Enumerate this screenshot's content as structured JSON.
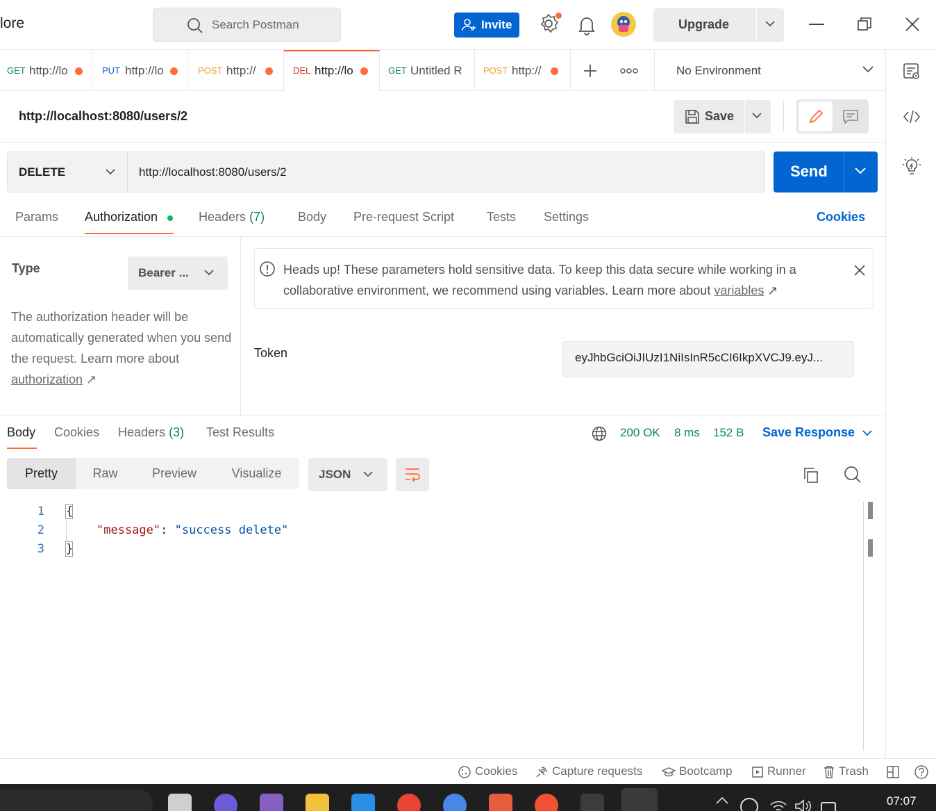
{
  "app": {
    "title_fragment": "lore"
  },
  "header": {
    "search_placeholder": "Search Postman",
    "invite_label": "Invite",
    "upgrade_label": "Upgrade"
  },
  "tabs": [
    {
      "method": "GET",
      "url": "http://lo",
      "dot": true
    },
    {
      "method": "PUT",
      "url": "http://lo",
      "dot": true
    },
    {
      "method": "POST",
      "url": "http://",
      "dot": true
    },
    {
      "method": "DEL",
      "url": "http://lo",
      "dot": true,
      "active": true
    },
    {
      "method": "GET",
      "url": "Untitled R",
      "dot": false
    },
    {
      "method": "POST",
      "url": "http://",
      "dot": true
    }
  ],
  "environment": {
    "selected": "No Environment"
  },
  "request": {
    "title": "http://localhost:8080/users/2",
    "save_label": "Save",
    "method": "DELETE",
    "url": "http://localhost:8080/users/2",
    "send_label": "Send"
  },
  "request_tabs": {
    "params": "Params",
    "authorization": "Authorization",
    "headers": "Headers",
    "headers_count": "(7)",
    "body": "Body",
    "pre_request": "Pre-request Script",
    "tests": "Tests",
    "settings": "Settings",
    "cookies": "Cookies"
  },
  "auth": {
    "type_label": "Type",
    "type_value": "Bearer ...",
    "description": "The authorization header will be automatically generated when you send the request. Learn more about",
    "description_link": "authorization",
    "alert_text": "Heads up! These parameters hold sensitive data. To keep this data secure while working in a collaborative environment, we recommend using variables. Learn more about",
    "alert_link": "variables",
    "token_label": "Token",
    "token_value": "eyJhbGciOiJIUzI1NiIsInR5cCI6IkpXVCJ9.eyJ..."
  },
  "response_tabs": {
    "body": "Body",
    "cookies": "Cookies",
    "headers": "Headers",
    "headers_count": "(3)",
    "test_results": "Test Results"
  },
  "response_status": {
    "status": "200 OK",
    "time": "8 ms",
    "size": "152 B",
    "save_response": "Save Response"
  },
  "views": {
    "pretty": "Pretty",
    "raw": "Raw",
    "preview": "Preview",
    "visualize": "Visualize",
    "format": "JSON"
  },
  "response_body": {
    "line_numbers": [
      "1",
      "2",
      "3"
    ],
    "open_brace": "{",
    "key": "\"message\"",
    "colon": ": ",
    "value": "\"success delete\"",
    "close_brace": "}"
  },
  "footer": {
    "cookies": "Cookies",
    "capture": "Capture requests",
    "bootcamp": "Bootcamp",
    "runner": "Runner",
    "trash": "Trash"
  },
  "taskbar": {
    "clock": "07:07"
  },
  "colors": {
    "accent_orange": "#ff6c37",
    "primary_blue": "#0265d2",
    "success_green": "#0b8a4a"
  }
}
